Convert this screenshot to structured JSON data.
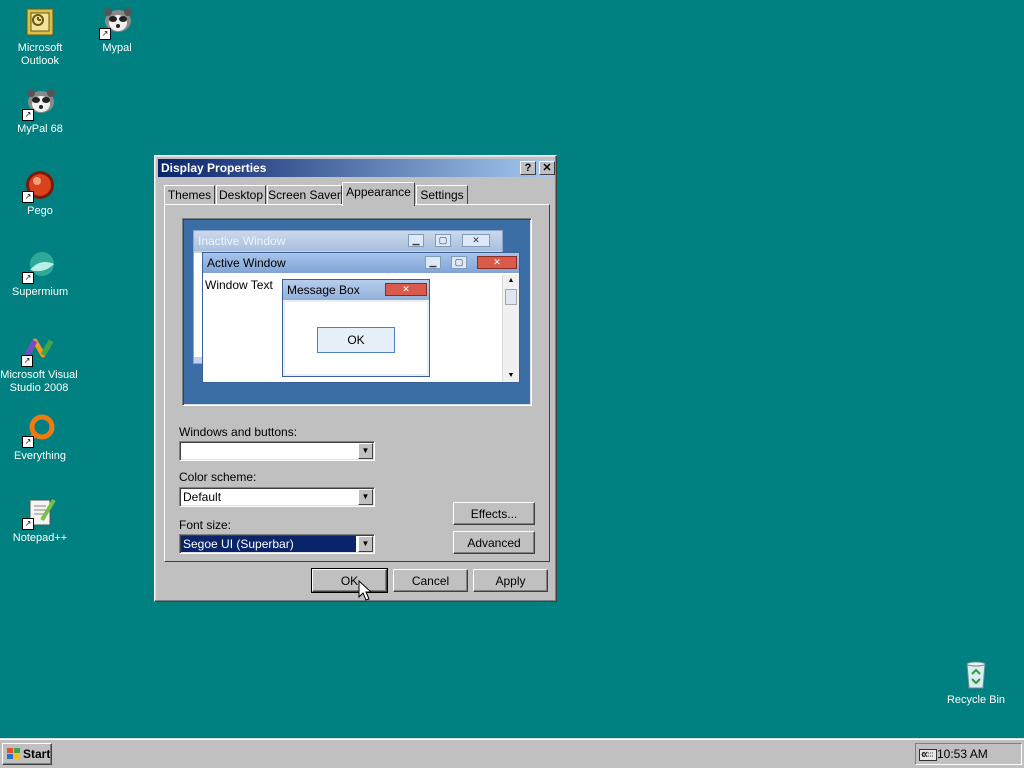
{
  "desktop": {
    "icons": [
      {
        "label": "Microsoft Outlook",
        "icon": "outlook-icon"
      },
      {
        "label": "Mypal",
        "icon": "mypal-icon"
      },
      {
        "label": "MyPal 68",
        "icon": "mypal-icon"
      },
      {
        "label": "Pego",
        "icon": "pego-icon"
      },
      {
        "label": "Supermium",
        "icon": "supermium-icon"
      },
      {
        "label": "Microsoft Visual Studio 2008",
        "icon": "visual-studio-icon"
      },
      {
        "label": "Everything",
        "icon": "everything-icon"
      },
      {
        "label": "Notepad++",
        "icon": "notepadpp-icon"
      },
      {
        "label": "Recycle Bin",
        "icon": "recycle-bin-icon"
      }
    ]
  },
  "dialog": {
    "title": "Display Properties",
    "help_glyph": "?",
    "close_glyph": "✕",
    "tabs": [
      "Themes",
      "Desktop",
      "Screen Saver",
      "Appearance",
      "Settings"
    ],
    "active_tab": "Appearance",
    "preview": {
      "inactive_title": "Inactive Window",
      "active_title": "Active Window",
      "window_text": "Window Text",
      "message_box_title": "Message Box",
      "message_box_ok": "OK"
    },
    "windows_buttons": {
      "label": "Windows and buttons:",
      "value": ""
    },
    "color_scheme": {
      "label": "Color scheme:",
      "value": "Default"
    },
    "font_size": {
      "label": "Font size:",
      "value": "Segoe UI (Superbar)"
    },
    "effects_label": "Effects...",
    "advanced_label": "Advanced",
    "ok_label": "OK",
    "cancel_label": "Cancel",
    "apply_label": "Apply"
  },
  "taskbar": {
    "start_label": "Start",
    "tray_expand": "«",
    "clock": "10:53 AM"
  },
  "colors": {
    "desktop": "#008080",
    "titlebar_start": "#0a246a",
    "titlebar_end": "#a6caf0",
    "selection": "#0a246a",
    "preview_bg": "#3a6ea5"
  }
}
